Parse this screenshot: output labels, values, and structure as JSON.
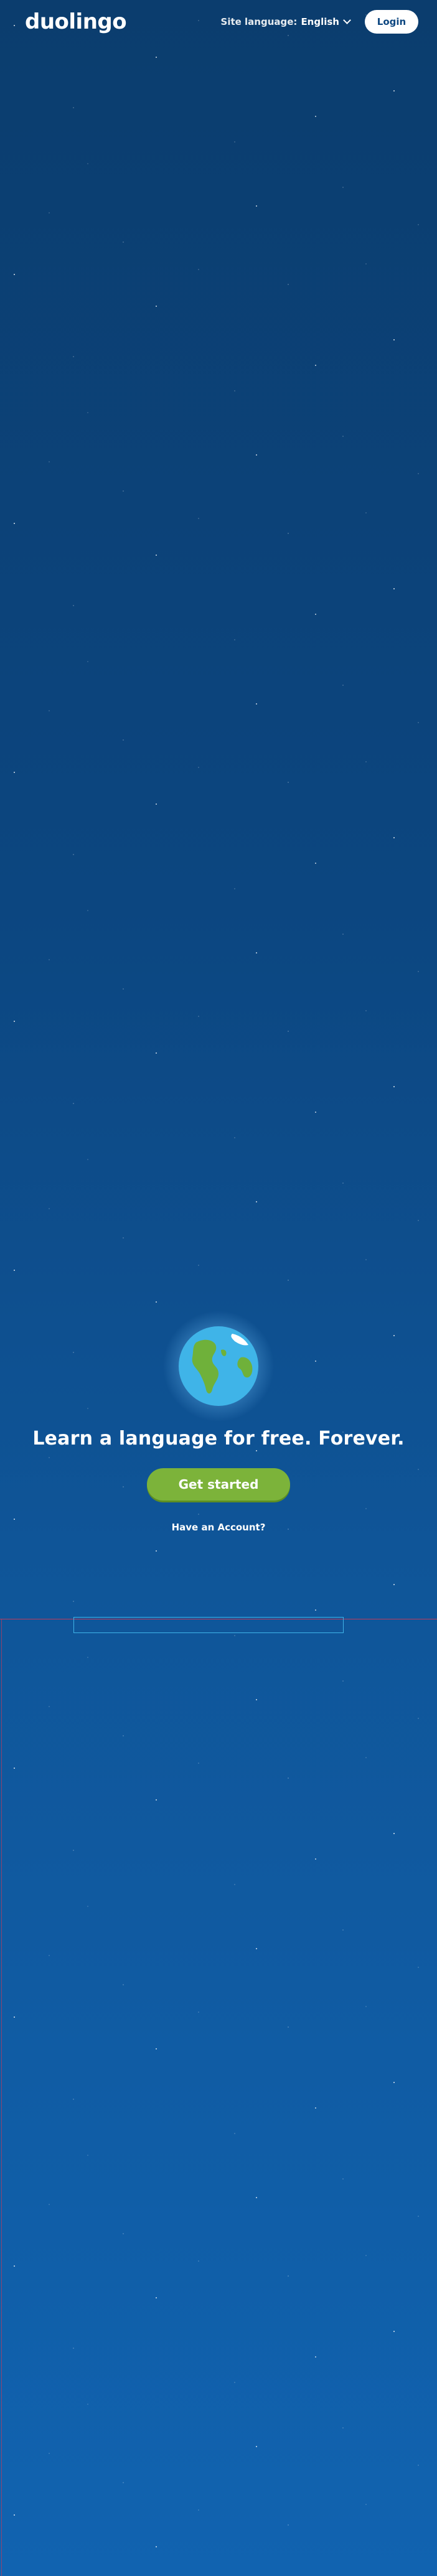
{
  "header": {
    "logo": "duolingo",
    "site_language_label": "Site language:",
    "site_language_value": "English",
    "login_label": "Login"
  },
  "hero": {
    "headline": "Learn a language for free. Forever.",
    "cta_label": "Get started",
    "account_link": "Have an Account?"
  },
  "colors": {
    "background_top": "#0b3d6e",
    "background_bottom": "#1163b0",
    "cta_green": "#7cb33a",
    "globe_ocean": "#3fb4e8",
    "globe_land": "#6fb13a"
  }
}
